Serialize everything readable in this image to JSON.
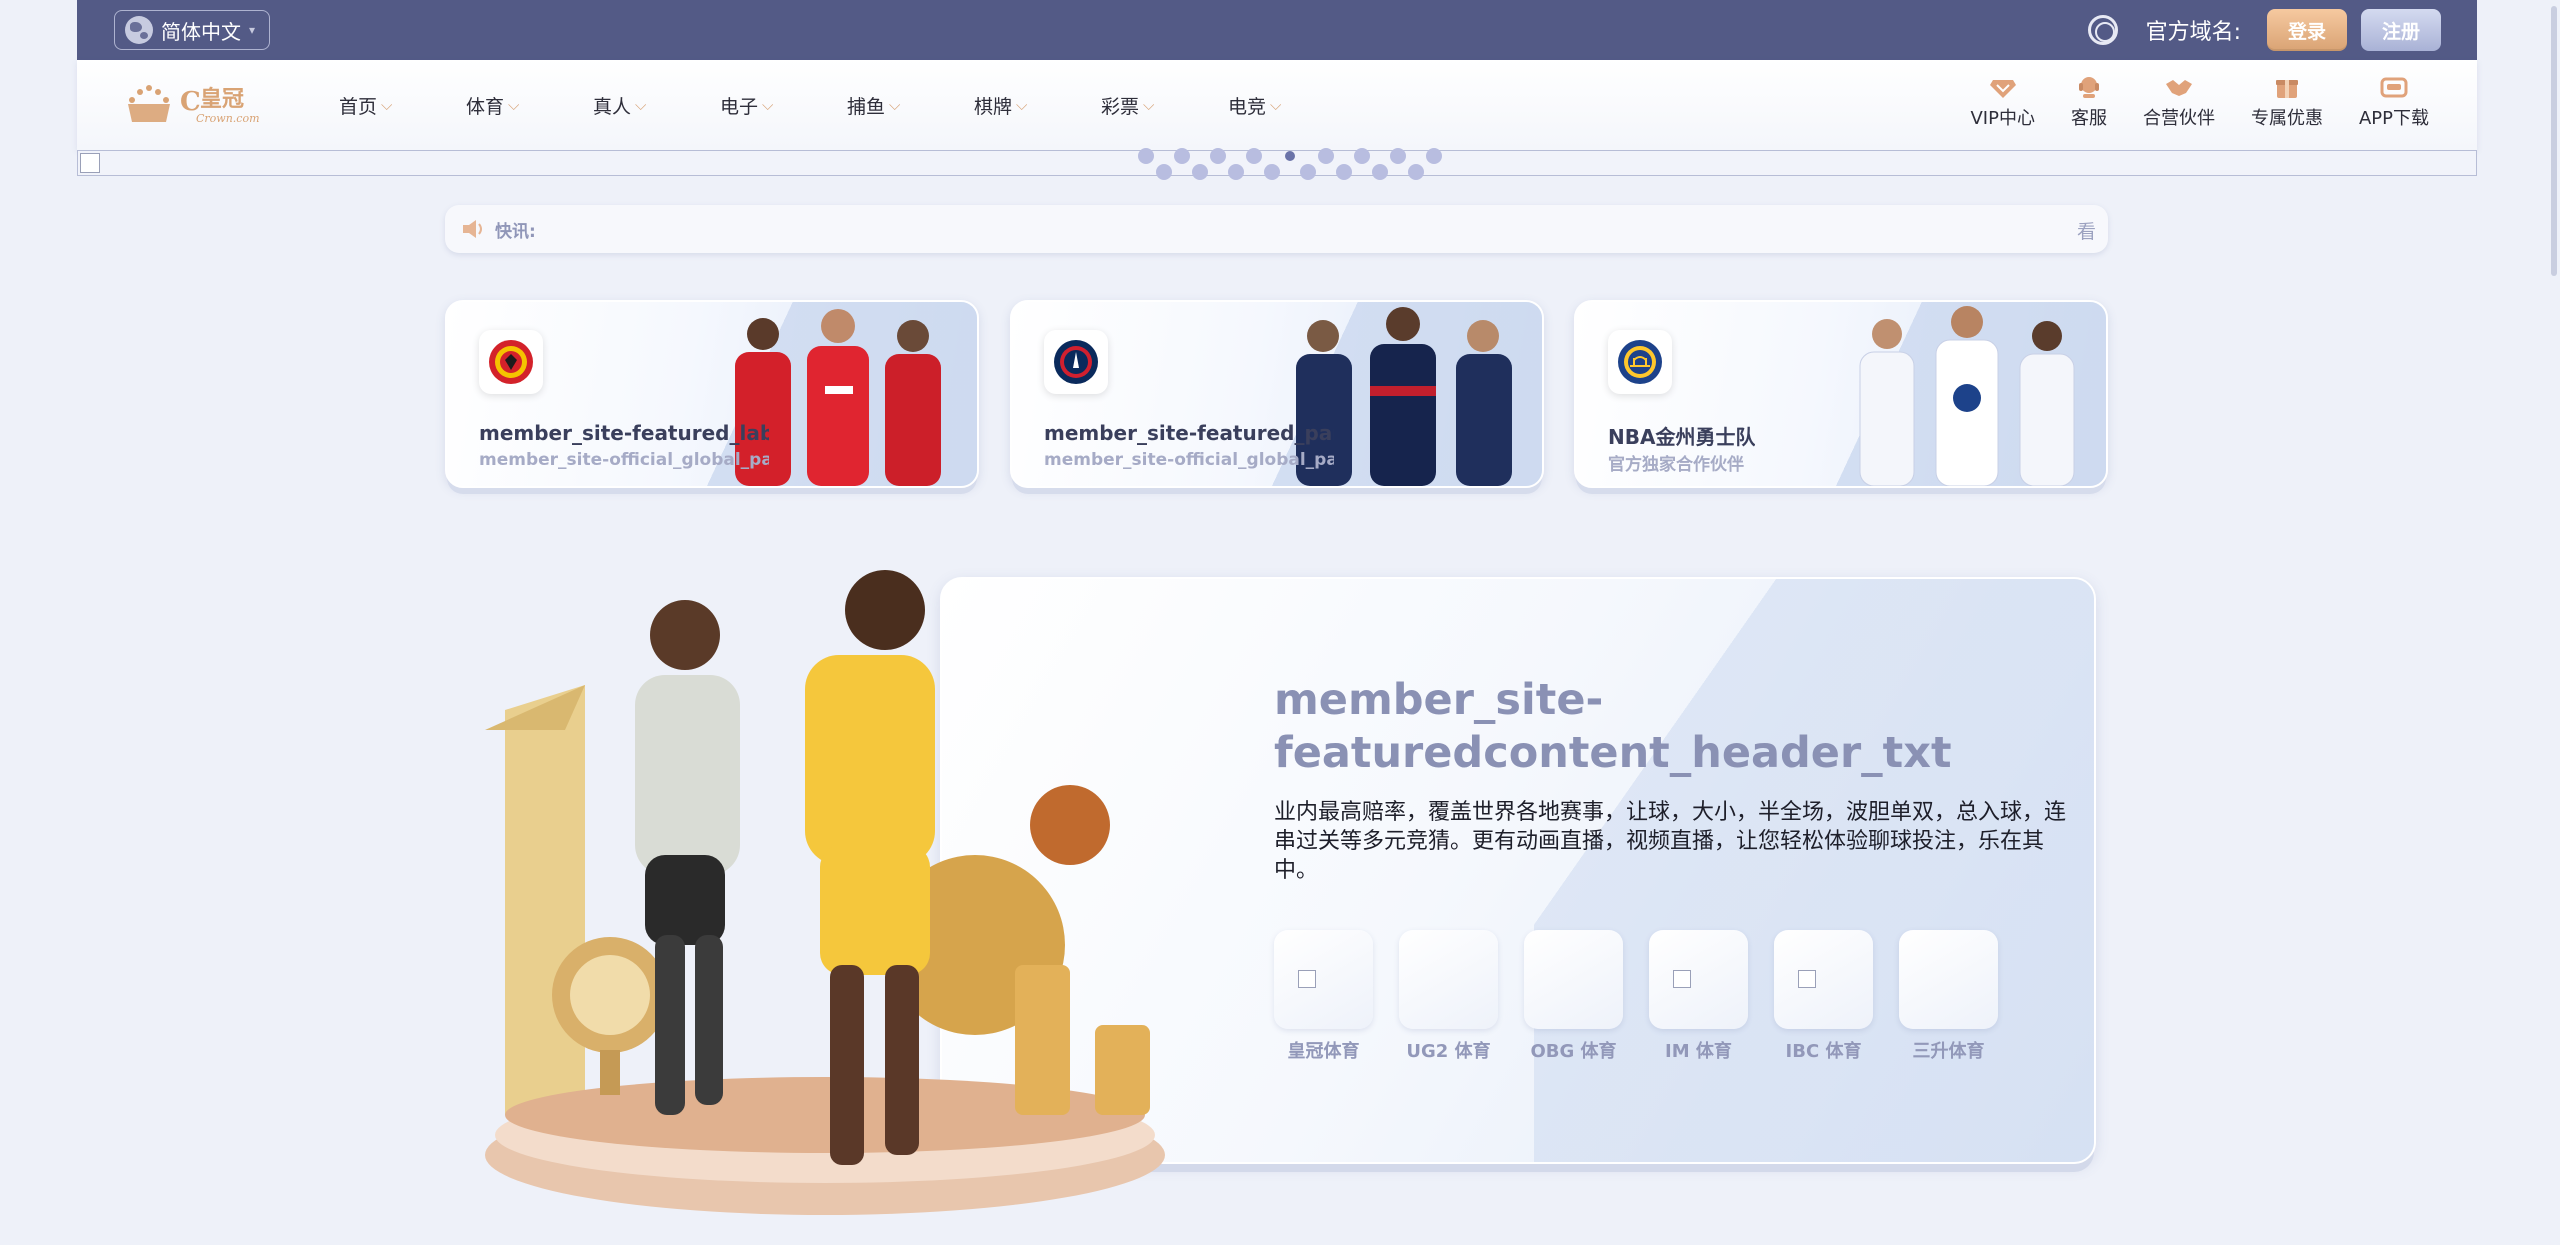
{
  "topbar": {
    "language": "简体中文",
    "domain_label": "官方域名:",
    "login_label": "登录",
    "register_label": "注册"
  },
  "nav": {
    "logo_text": "皇冠",
    "logo_subtext": "Crown.com",
    "menu": [
      {
        "label": "首页"
      },
      {
        "label": "体育"
      },
      {
        "label": "真人"
      },
      {
        "label": "电子"
      },
      {
        "label": "捕鱼"
      },
      {
        "label": "棋牌"
      },
      {
        "label": "彩票"
      },
      {
        "label": "电竞"
      }
    ],
    "right_items": [
      {
        "label": "VIP中心",
        "icon": "vip-icon"
      },
      {
        "label": "客服",
        "icon": "customer-service-icon"
      },
      {
        "label": "合营伙伴",
        "icon": "handshake-icon"
      },
      {
        "label": "专属优惠",
        "icon": "gift-icon"
      },
      {
        "label": "APP下载",
        "icon": "app-download-icon"
      }
    ]
  },
  "notice": {
    "label": "快讯:",
    "trailing_char": "看"
  },
  "cards": [
    {
      "title": "member_site-featured_label_man",
      "subtitle": "member_site-official_global_partner",
      "badge": "man-utd-crest-icon"
    },
    {
      "title": "member_site-featured_paris",
      "subtitle": "member_site-official_global_partner",
      "badge": "psg-crest-icon"
    },
    {
      "title": "NBA金州勇士队",
      "subtitle": "官方独家合作伙伴",
      "badge": "warriors-crest-icon"
    }
  ],
  "featured": {
    "title": "member_site-featuredcontent_header_txt",
    "description": "业内最高赔率，覆盖世界各地赛事，让球，大小，半全场，波胆单双，总入球，连串过关等多元竞猜。更有动画直播，视频直播，让您轻松体验聊球投注，乐在其中。",
    "providers": [
      {
        "name": "皇冠体育",
        "broken_image": true
      },
      {
        "name": "UG2 体育",
        "broken_image": false
      },
      {
        "name": "OBG 体育",
        "broken_image": false
      },
      {
        "name": "IM 体育",
        "broken_image": true
      },
      {
        "name": "IBC 体育",
        "broken_image": true
      },
      {
        "name": "三升体育",
        "broken_image": false
      }
    ]
  },
  "colors": {
    "topbar_bg": "#535a86",
    "accent_gold": "#d9a374",
    "page_bg": "#eef1f9"
  }
}
